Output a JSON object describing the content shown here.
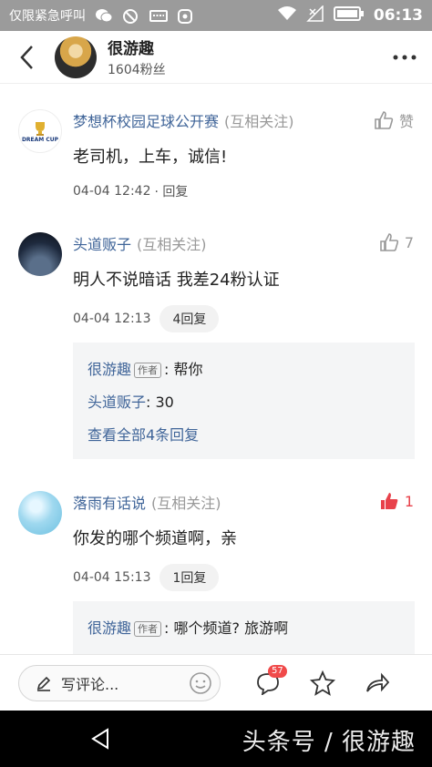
{
  "status_bar": {
    "carrier": "仅限紧急呼叫",
    "time": "06:13",
    "icons": [
      "wechat-icon",
      "block-icon",
      "keyboard-icon",
      "app-icon",
      "wifi-icon",
      "signal-icon",
      "battery-icon"
    ]
  },
  "header": {
    "title": "很游趣",
    "subtitle": "1604粉丝"
  },
  "comments": [
    {
      "name": "梦想杯校园足球公开赛",
      "mutual": "(互相关注)",
      "like_label": "赞",
      "liked": false,
      "text": "老司机，上车，诚信!",
      "time": "04-04 12:42",
      "reply_link": "· 回复",
      "avatar_text": "DREAM CUP"
    },
    {
      "name": "头道贩子",
      "mutual": "(互相关注)",
      "like_label": "7",
      "liked": false,
      "text": "明人不说暗话 我差24粉认证",
      "time": "04-04 12:13",
      "reply_pill": "4回复",
      "replies": [
        {
          "name": "很游趣",
          "author_tag": "作者",
          "text": ": 帮你"
        },
        {
          "name": "头道贩子",
          "text": ": 30"
        }
      ],
      "view_all": "查看全部4条回复"
    },
    {
      "name": "落雨有话说",
      "mutual": "(互相关注)",
      "like_label": "1",
      "liked": true,
      "text": "你发的哪个频道啊，亲",
      "time": "04-04 15:13",
      "reply_pill": "1回复",
      "replies": [
        {
          "name": "很游趣",
          "author_tag": "作者",
          "text": ": 哪个频道? 旅游啊"
        }
      ]
    }
  ],
  "bottom_bar": {
    "write_placeholder": "写评论...",
    "comment_badge": "57"
  },
  "watermark": "头条号 / 很游趣",
  "colors": {
    "link_blue": "#406599",
    "like_red": "#e8414a",
    "status_gray": "#9b9b9b"
  }
}
